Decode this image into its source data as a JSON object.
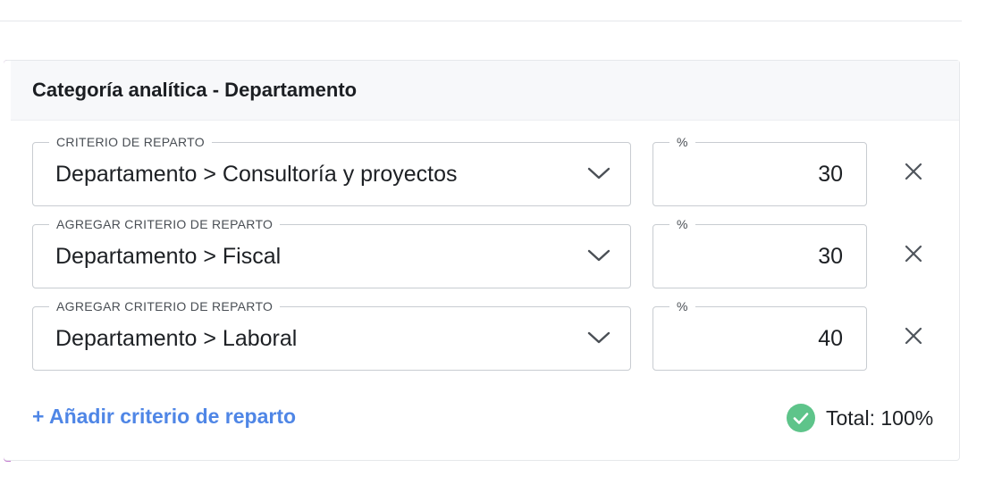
{
  "card": {
    "title": "Categoría analítica - Departamento",
    "accent_color": "#c57bd0"
  },
  "rows": [
    {
      "criterion_label": "CRITERIO DE REPARTO",
      "criterion_value": "Departamento > Consultoría y proyectos",
      "percent_label": "%",
      "percent_value": "30",
      "remove_icon": "close-icon"
    },
    {
      "criterion_label": "AGREGAR CRITERIO DE REPARTO",
      "criterion_value": "Departamento > Fiscal",
      "percent_label": "%",
      "percent_value": "30",
      "remove_icon": "close-icon"
    },
    {
      "criterion_label": "AGREGAR CRITERIO DE REPARTO",
      "criterion_value": "Departamento > Laboral",
      "percent_label": "%",
      "percent_value": "40",
      "remove_icon": "close-icon"
    }
  ],
  "footer": {
    "add_link": "+ Añadir criterio de reparto",
    "total_label": "Total: 100%",
    "total_icon": "check-circle-icon",
    "link_color": "#4f86e6",
    "success_color": "#5ec48a"
  }
}
